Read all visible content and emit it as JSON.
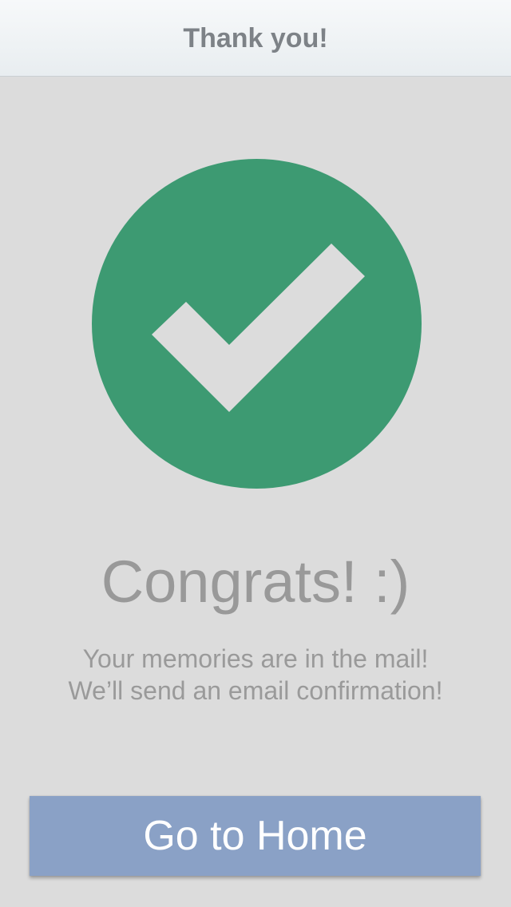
{
  "header": {
    "title": "Thank you!"
  },
  "success": {
    "icon": "checkmark-icon",
    "badge_color": "#3d9a72",
    "check_color": "#dcdcdc"
  },
  "main": {
    "headline": "Congrats! :)",
    "message_line1": "Your memories are in the mail!",
    "message_line2": "We’ll send an email confirmation!"
  },
  "actions": {
    "home_label": "Go to Home",
    "home_color": "#8aa1c6"
  }
}
